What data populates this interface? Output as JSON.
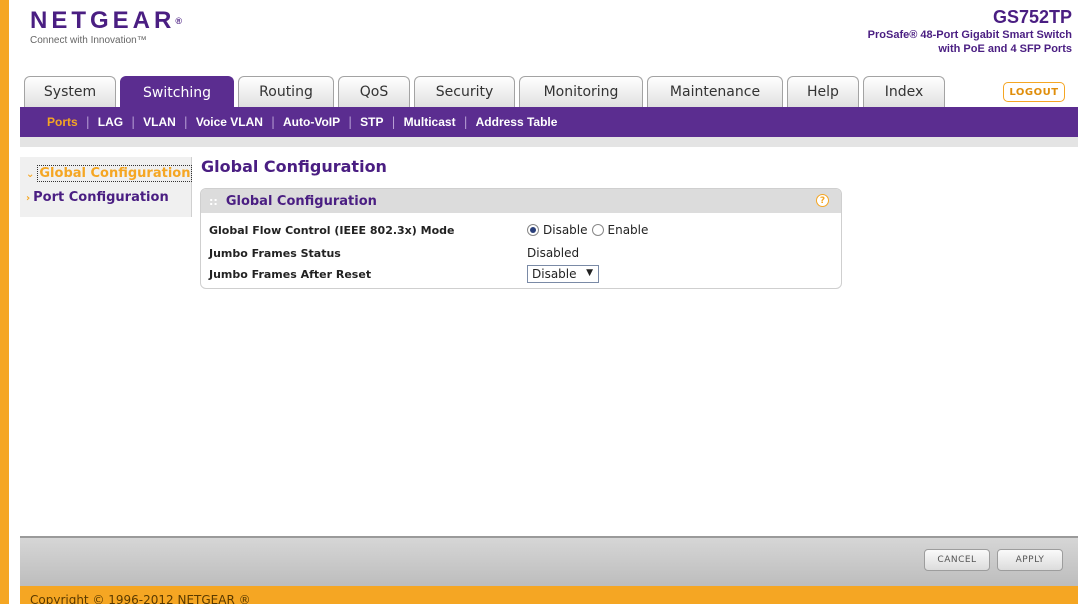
{
  "brand": {
    "logo_text": "NETGEAR",
    "logo_mark": "®",
    "tagline": "Connect with Innovation™",
    "model": "GS752TP",
    "model_line1": "ProSafe® 48-Port Gigabit Smart Switch",
    "model_line2": "with PoE and 4 SFP Ports",
    "accent_color": "#f5a623",
    "primary_color": "#5b2d90"
  },
  "tabs": [
    {
      "label": "System"
    },
    {
      "label": "Switching"
    },
    {
      "label": "Routing"
    },
    {
      "label": "QoS"
    },
    {
      "label": "Security"
    },
    {
      "label": "Monitoring"
    },
    {
      "label": "Maintenance"
    },
    {
      "label": "Help"
    },
    {
      "label": "Index"
    }
  ],
  "active_tab": "Switching",
  "logout_label": "LOGOUT",
  "subnav": [
    {
      "label": "Ports"
    },
    {
      "label": "LAG"
    },
    {
      "label": "VLAN"
    },
    {
      "label": "Voice VLAN"
    },
    {
      "label": "Auto-VoIP"
    },
    {
      "label": "STP"
    },
    {
      "label": "Multicast"
    },
    {
      "label": "Address Table"
    }
  ],
  "active_subnav": "Ports",
  "leftnav": [
    {
      "label": "Global Configuration",
      "icon": "chevron-down-icon"
    },
    {
      "label": "Port Configuration",
      "icon": "chevron-right-icon"
    }
  ],
  "active_leftnav": "Global Configuration",
  "page_title": "Global Configuration",
  "panel": {
    "title": "Global Configuration",
    "help_glyph": "?",
    "flow_control_label": "Global Flow Control (IEEE 802.3x) Mode",
    "flow_control_options": [
      "Disable",
      "Enable"
    ],
    "flow_control_selected": "Disable",
    "jumbo_status_label": "Jumbo Frames Status",
    "jumbo_status_value": "Disabled",
    "jumbo_reset_label": "Jumbo Frames After Reset",
    "jumbo_reset_value": "Disable"
  },
  "buttons": {
    "cancel": "CANCEL",
    "apply": "APPLY"
  },
  "copyright": "Copyright © 1996-2012 NETGEAR ®"
}
